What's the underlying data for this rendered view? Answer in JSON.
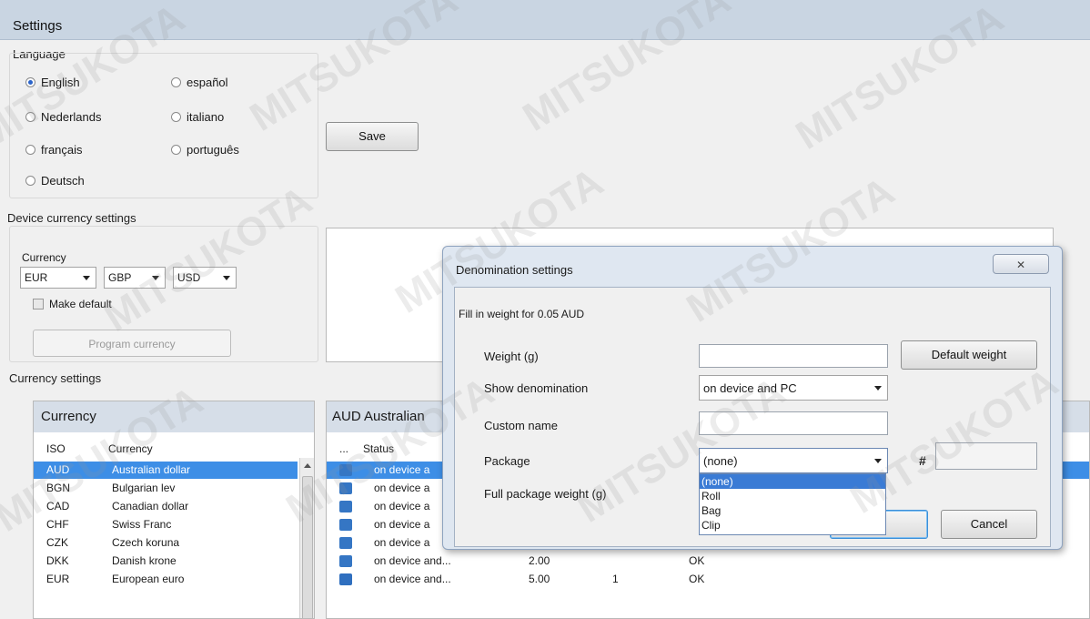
{
  "window": {
    "title": "Settings"
  },
  "language": {
    "label": "Language",
    "options": [
      "English",
      "español",
      "Nederlands",
      "italiano",
      "français",
      "português",
      "Deutsch"
    ],
    "selected": "English"
  },
  "save_label": "Save",
  "device_currency": {
    "label": "Device currency settings",
    "currency_label": "Currency",
    "combos": [
      "EUR",
      "GBP",
      "USD"
    ],
    "make_default": "Make default",
    "program_button": "Program currency"
  },
  "currency_settings": {
    "label": "Currency settings",
    "list_title": "Currency",
    "columns": {
      "iso": "ISO",
      "name": "Currency"
    },
    "rows": [
      {
        "iso": "AUD",
        "name": "Australian dollar"
      },
      {
        "iso": "BGN",
        "name": "Bulgarian lev"
      },
      {
        "iso": "CAD",
        "name": "Canadian dollar"
      },
      {
        "iso": "CHF",
        "name": "Swiss Franc"
      },
      {
        "iso": "CZK",
        "name": "Czech koruna"
      },
      {
        "iso": "DKK",
        "name": "Danish krone"
      },
      {
        "iso": "EUR",
        "name": "European euro"
      }
    ],
    "selected_iso": "AUD"
  },
  "denom_panel": {
    "title": "AUD Australian",
    "col_more": "...",
    "col_status": "Status",
    "rows": [
      {
        "status": "on device a",
        "value": "",
        "count": "",
        "result": ""
      },
      {
        "status": "on device a",
        "value": "",
        "count": "",
        "result": ""
      },
      {
        "status": "on device a",
        "value": "",
        "count": "",
        "result": ""
      },
      {
        "status": "on device a",
        "value": "",
        "count": "",
        "result": ""
      },
      {
        "status": "on device a",
        "value": "",
        "count": "",
        "result": ""
      },
      {
        "status": "on device and...",
        "value": "2.00",
        "count": "",
        "result": "OK"
      },
      {
        "status": "on device and...",
        "value": "5.00",
        "count": "1",
        "result": "OK"
      }
    ]
  },
  "dialog": {
    "title": "Denomination settings",
    "close_glyph": "✕",
    "instruction": "Fill in weight for 0.05 AUD",
    "weight_label": "Weight (g)",
    "weight_value": "",
    "default_weight_button": "Default weight",
    "show_label": "Show denomination",
    "show_value": "on device and PC",
    "custom_name_label": "Custom name",
    "custom_name_value": "",
    "package_label": "Package",
    "package_value": "(none)",
    "package_options": [
      "(none)",
      "Roll",
      "Bag",
      "Clip"
    ],
    "hash_label": "#",
    "hash_value": "",
    "full_weight_label": "Full package weight (g)",
    "ok_button": "",
    "cancel_button": "Cancel"
  },
  "watermark": "MITSUKOTA"
}
